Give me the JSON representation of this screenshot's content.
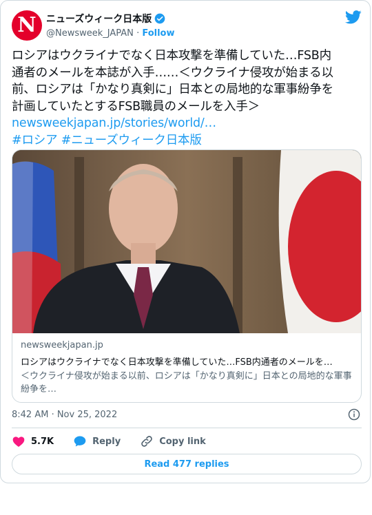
{
  "account": {
    "display_name": "ニューズウィーク日本版",
    "handle": "@Newsweek_JAPAN",
    "separator": "·",
    "follow_label": "Follow",
    "avatar_letter": "N"
  },
  "tweet": {
    "lines": [
      "ロシアはウクライナでなく日本攻撃を準備していた…FSB内",
      "通者のメールを本誌が入手……＜ウクライナ侵攻が始まる以",
      "前、ロシアは「かなり真剣に」日本との局地的な軍事紛争を",
      "計画していたとするFSB職員のメールを入手＞"
    ],
    "link": "newsweekjapan.jp/stories/world/…",
    "hashtags": "#ロシア #ニューズウィーク日本版"
  },
  "link_card": {
    "domain": "newsweekjapan.jp",
    "title": "ロシアはウクライナでなく日本攻撃を準備していた…FSB内通者のメールを…",
    "description": "＜ウクライナ侵攻が始まる以前、ロシアは「かなり真剣に」日本との局地的な軍事紛争を…"
  },
  "meta": {
    "timestamp": "8:42 AM · Nov 25, 2022"
  },
  "actions": {
    "like_count": "5.7K",
    "reply_label": "Reply",
    "copy_link_label": "Copy link"
  },
  "read_replies_label": "Read 477 replies",
  "colors": {
    "accent": "#1d9bf0",
    "like": "#f91880",
    "avatar_bg": "#e4002b"
  },
  "icons": [
    "verified-badge-icon",
    "twitter-bird-icon",
    "info-icon",
    "heart-icon",
    "reply-bubble-icon",
    "link-icon"
  ]
}
